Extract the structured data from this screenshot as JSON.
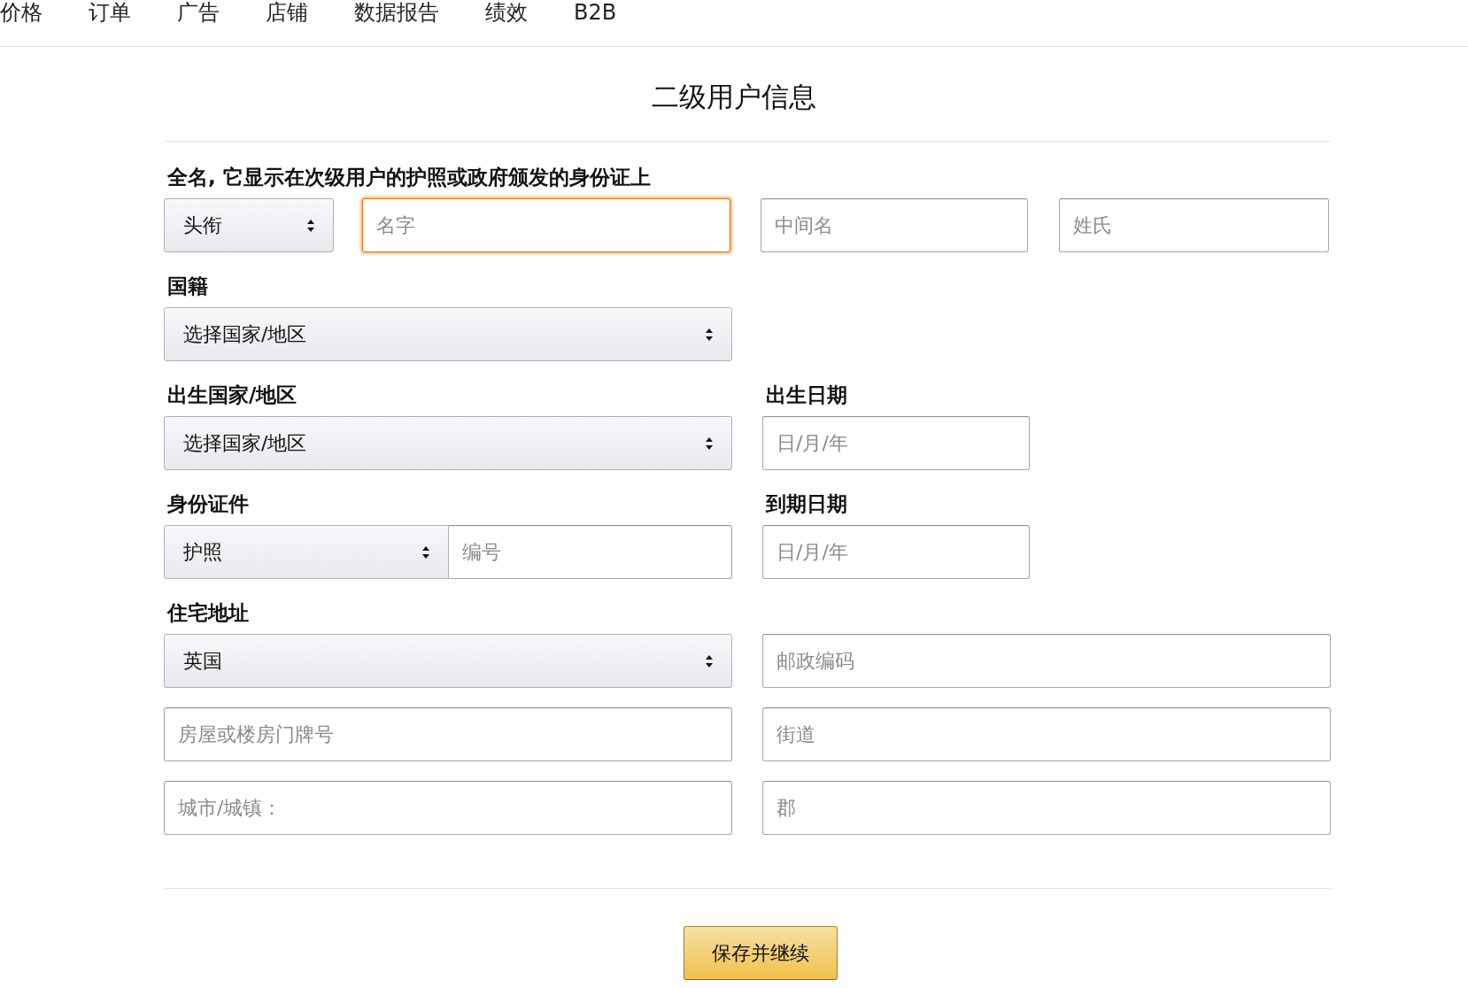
{
  "nav": [
    "价格",
    "订单",
    "广告",
    "店铺",
    "数据报告",
    "绩效",
    "B2B"
  ],
  "title": "二级用户信息",
  "full_name": {
    "label": "全名, 它显示在次级用户的护照或政府颁发的身份证上",
    "title_select": "头衔",
    "fields": [
      {
        "placeholder": "名字",
        "focused": true
      },
      {
        "placeholder": "中间名",
        "focused": false
      },
      {
        "placeholder": "姓氏",
        "focused": false
      }
    ]
  },
  "nationality": {
    "label": "国籍",
    "select": "选择国家/地区"
  },
  "birth_country": {
    "label": "出生国家/地区",
    "select": "选择国家/地区"
  },
  "birth_date": {
    "label": "出生日期",
    "placeholder": "日/月/年"
  },
  "id_document": {
    "label": "身份证件",
    "type_select": "护照",
    "number_placeholder": "编号"
  },
  "expiry_date": {
    "label": "到期日期",
    "placeholder": "日/月/年"
  },
  "address": {
    "label": "住宅地址",
    "country_select": "英国",
    "fields": [
      {
        "placeholder": "邮政编码"
      },
      {
        "placeholder": "房屋或楼房门牌号"
      },
      {
        "placeholder": "街道"
      },
      {
        "placeholder": "城市/城镇："
      },
      {
        "placeholder": "郡"
      }
    ]
  },
  "button": "保存并继续"
}
